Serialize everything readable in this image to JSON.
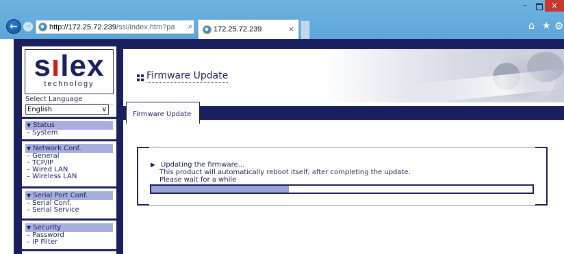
{
  "browser": {
    "address_host": "http://172.25.72.239",
    "address_path": "/ssi/index.htm?pa",
    "address_tools": "⌕ ▾ ↻",
    "tab_title": "172.25.72.239",
    "tab_close": "×",
    "win_min": "–",
    "win_close": "×",
    "back_glyph": "←",
    "fwd_glyph": "→",
    "home_glyph": "⌂",
    "star_glyph": "★",
    "gear_glyph": "⚙"
  },
  "sidebar": {
    "logo_pre": "s",
    "logo_i": "ı",
    "logo_post": "lex",
    "logo_tag": "technology",
    "lang_label": "Select Language",
    "lang_value": "English",
    "lang_chev": "∨",
    "menus": [
      {
        "head": "Status",
        "items": [
          "– System"
        ]
      },
      {
        "head": "Network Conf.",
        "items": [
          "– General",
          "– TCP/IP",
          "– Wired LAN",
          "– Wireless LAN"
        ]
      },
      {
        "head": "Serial Port Conf.",
        "items": [
          "– Serial Conf.",
          "– Serial Service"
        ]
      },
      {
        "head": "Security",
        "items": [
          "– Password",
          "– IP Filter"
        ]
      }
    ]
  },
  "main": {
    "page_title": "Firmware Update",
    "tab_label": "Firmware Update",
    "status_arrow": "▶",
    "status_line1": "Updating the firmware...",
    "status_line2": "This product will automatically reboot itself, after completing the update.",
    "status_line3": "Please wait for a while",
    "progress_fraction": 0.36
  },
  "colors": {
    "brand_navy": "#1a1f5e",
    "menu_head_bg": "#a7aede",
    "progress_fill": "#98a3d8",
    "chrome_blue": "#5da6d8"
  }
}
